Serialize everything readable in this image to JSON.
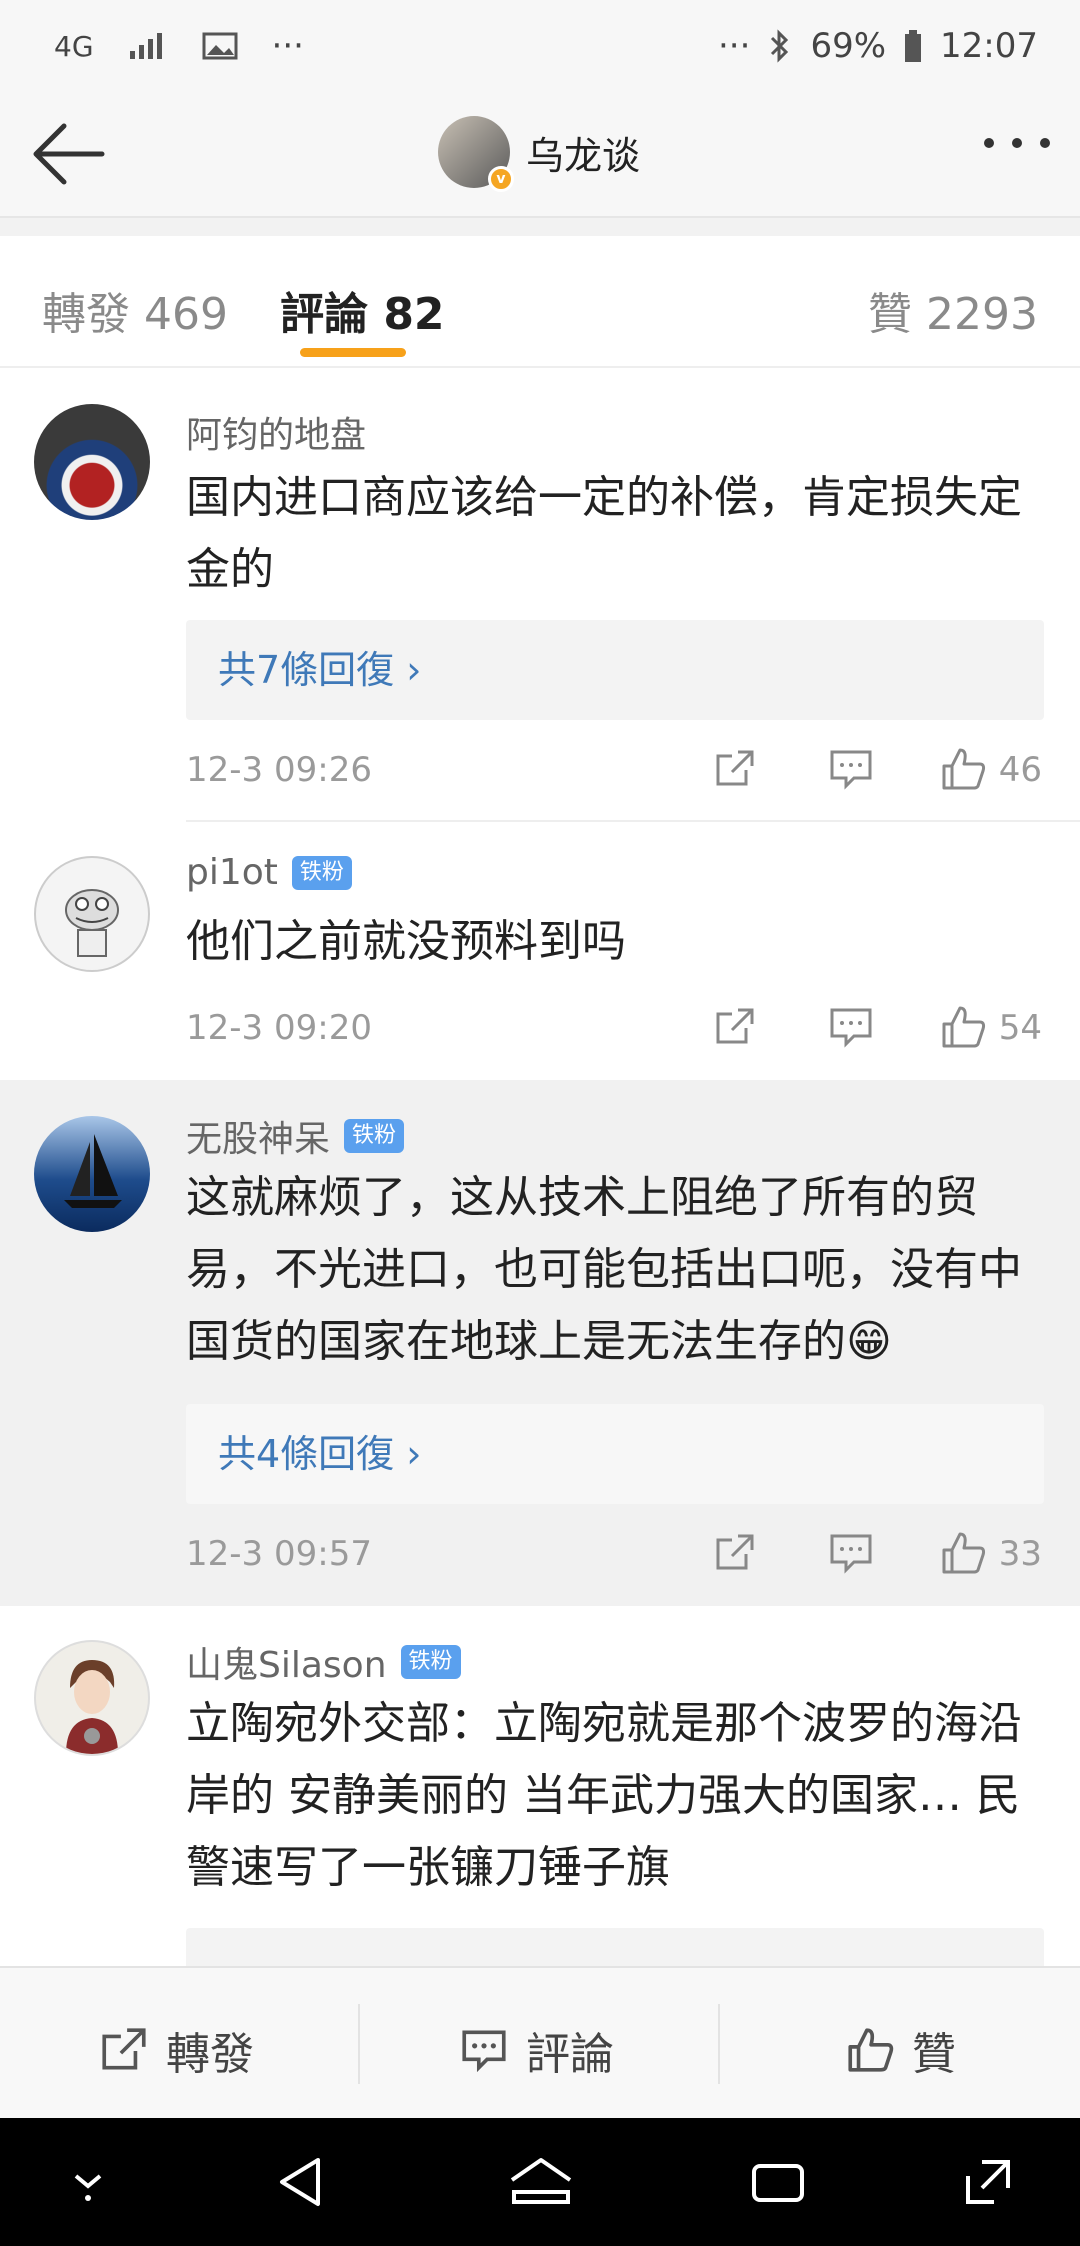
{
  "status_bar": {
    "network": "4G",
    "battery": "69%",
    "time": "12:07",
    "dots": "···"
  },
  "header": {
    "title": "乌龙谈",
    "verified": "v"
  },
  "tabs": [
    {
      "label": "轉發 469"
    },
    {
      "label": "評論 82"
    },
    {
      "label": "贊 2293"
    }
  ],
  "comments": [
    {
      "name": "阿钧的地盘",
      "badge": "",
      "text": "国内进口商应该给一定的补偿，肯定损失定金的",
      "replies": "共7條回復 ›",
      "time": "12-3 09:26",
      "likes": "46"
    },
    {
      "name": "pi1ot",
      "badge": "铁粉",
      "text": "他们之前就没预料到吗",
      "replies": "",
      "time": "12-3 09:20",
      "likes": "54"
    },
    {
      "name": "无股神呆",
      "badge": "铁粉",
      "text": "这就麻烦了，这从技术上阻绝了所有的贸易，不光进口，也可能包括出口呃，没有中国货的国家在地球上是无法生存的😁",
      "replies": "共4條回復 ›",
      "time": "12-3 09:57",
      "likes": "33"
    },
    {
      "name": "山鬼Silason",
      "badge": "铁粉",
      "text": "立陶宛外交部：立陶宛就是那个波罗的海沿岸的  安静美丽的  当年武力强大的国家… 民警速写了一张镰刀锤子旗",
      "replies": "",
      "time": "",
      "likes": ""
    }
  ],
  "bottom_bar": {
    "repost": "轉發",
    "comment": "評論",
    "like": "贊"
  },
  "colors": {
    "accent": "#f7a11a",
    "link": "#3f79b8",
    "badge": "#5aa0ee"
  }
}
